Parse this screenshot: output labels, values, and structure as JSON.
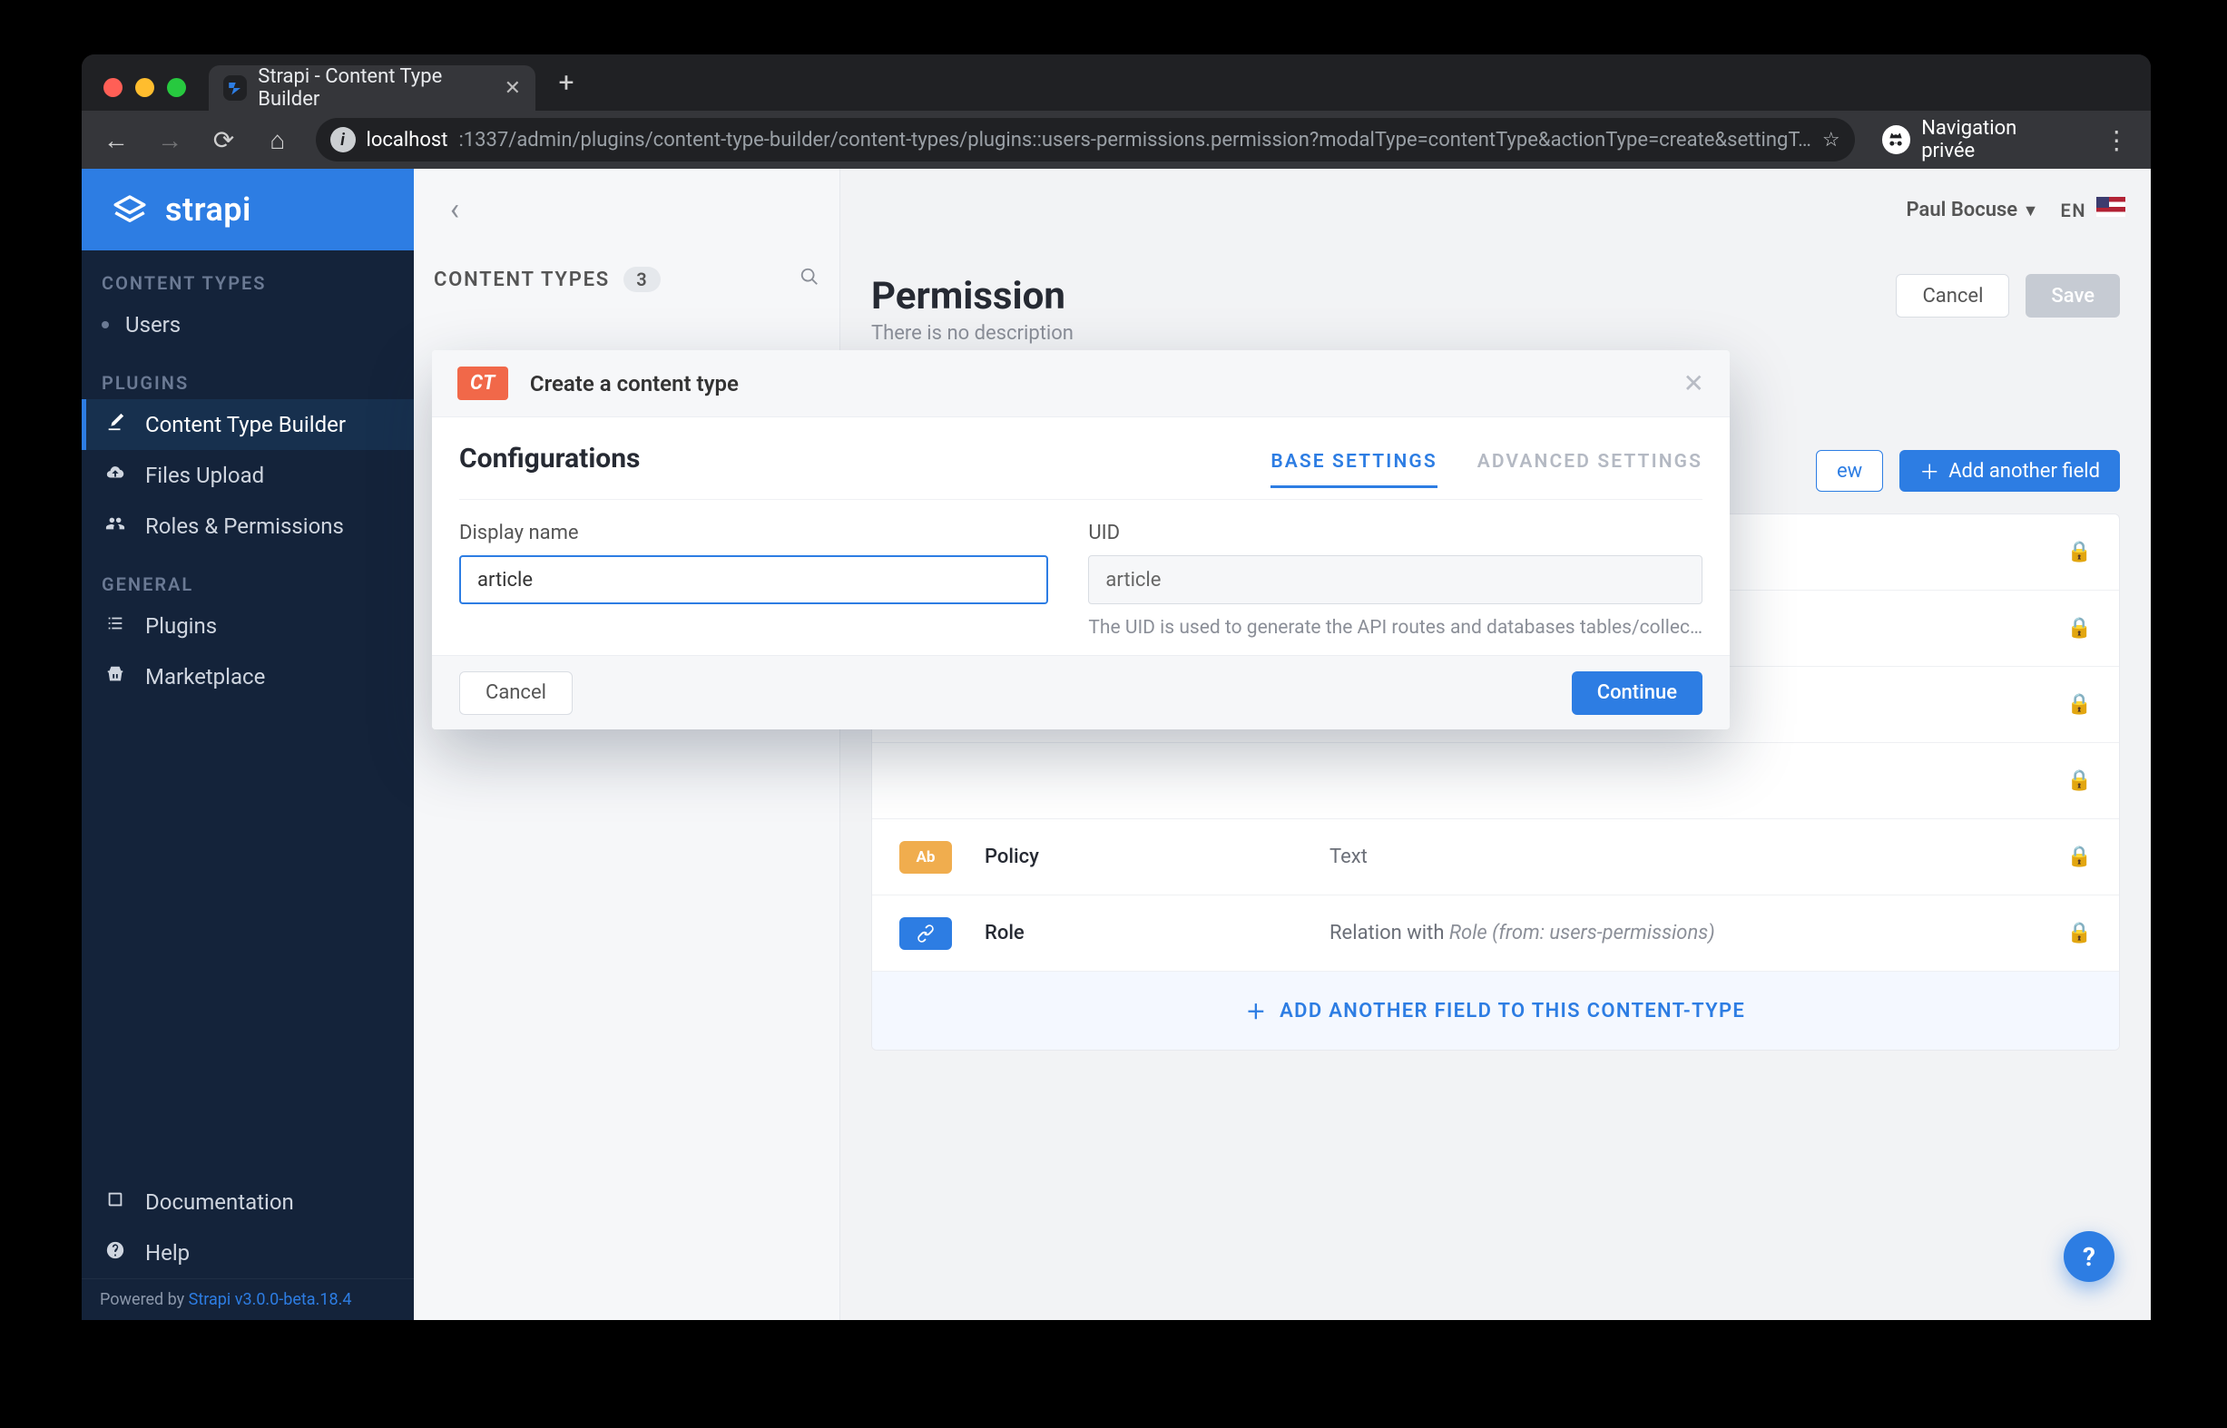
{
  "browser": {
    "tab_title": "Strapi - Content Type Builder",
    "url_host": "localhost",
    "url_rest": ":1337/admin/plugins/content-type-builder/content-types/plugins::users-permissions.permission?modalType=contentType&actionType=create&settingT…",
    "incognito_label": "Navigation privée"
  },
  "brand": {
    "name": "strapi"
  },
  "sidebar": {
    "sections": {
      "content_types": "CONTENT TYPES",
      "plugins": "PLUGINS",
      "general": "GENERAL"
    },
    "items": {
      "users": "Users",
      "ctb": "Content Type Builder",
      "files": "Files Upload",
      "roles": "Roles & Permissions",
      "plugins": "Plugins",
      "marketplace": "Marketplace",
      "documentation": "Documentation",
      "help": "Help"
    },
    "powered_prefix": "Powered by ",
    "powered_link": "Strapi v3.0.0-beta.18.4"
  },
  "panel": {
    "header": "CONTENT TYPES",
    "count": "3"
  },
  "topbar": {
    "user": "Paul Bocuse",
    "lang": "EN"
  },
  "page": {
    "title": "Permission",
    "subtitle": "There is no description",
    "cancel": "Cancel",
    "save": "Save",
    "configure_view": "ew",
    "add_field": "Add another field",
    "add_row": "ADD ANOTHER FIELD TO THIS CONTENT-TYPE"
  },
  "fields": [
    {
      "name": "",
      "type": "",
      "lock": true
    },
    {
      "name": "",
      "type": "",
      "lock": true
    },
    {
      "name": "",
      "type": "",
      "lock": true
    },
    {
      "name": "",
      "type": "",
      "lock": true
    },
    {
      "name": "Policy",
      "type": "Text",
      "lock": true,
      "tag": "Ab"
    },
    {
      "name": "Role",
      "type_html": "Relation with ",
      "type_em": "Role (from: users-permissions)",
      "lock": true,
      "tag": "rel"
    }
  ],
  "modal": {
    "badge": "CT",
    "title": "Create a content type",
    "config_title": "Configurations",
    "tab_base": "BASE SETTINGS",
    "tab_advanced": "ADVANCED SETTINGS",
    "display_label": "Display name",
    "display_value": "article",
    "uid_label": "UID",
    "uid_value": "article",
    "uid_hint": "The UID is used to generate the API routes and databases tables/collec…",
    "cancel": "Cancel",
    "continue": "Continue"
  },
  "help": "?"
}
